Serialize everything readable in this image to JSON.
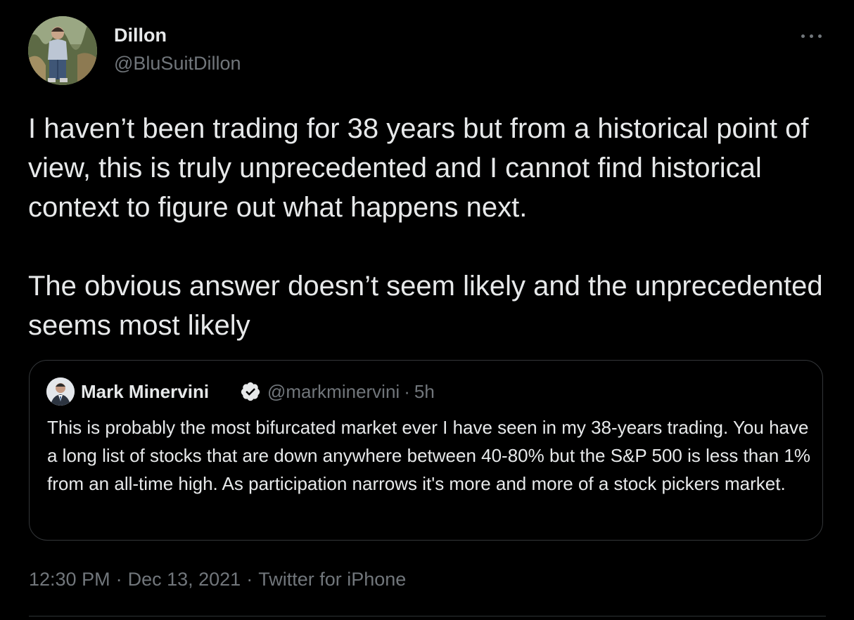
{
  "author": {
    "name": "Dillon",
    "handle": "@BluSuitDillon",
    "avatar_icon": "profile-photo"
  },
  "menu": {
    "more_icon": "more-horizontal-icon"
  },
  "tweet": {
    "paragraphs": [
      "I haven’t been trading for 38 years but from a historical point of view, this is truly unprecedented and I cannot find historical context to figure out what happens next.",
      "The obvious answer doesn’t seem likely and the unprecedented seems most likely"
    ]
  },
  "quoted_tweet": {
    "name": "Mark Minervini",
    "verified_icon": "verified-badge-icon",
    "handle": "@markminervini",
    "separator": "·",
    "age": "5h",
    "text": "This is probably the most bifurcated market ever I have seen in my 38-years trading. You have a long list of stocks that are down anywhere between 40-80% but the S&P 500 is less than 1% from an all-time high. As participation narrows it's more and more of a stock pickers market."
  },
  "meta": {
    "time": "12:30 PM",
    "separator": "·",
    "date": "Dec 13, 2021",
    "source": "Twitter for iPhone"
  },
  "colors": {
    "background": "#000000",
    "primary_text": "#e7e9ea",
    "secondary_text": "#71767b",
    "border": "#333639"
  }
}
